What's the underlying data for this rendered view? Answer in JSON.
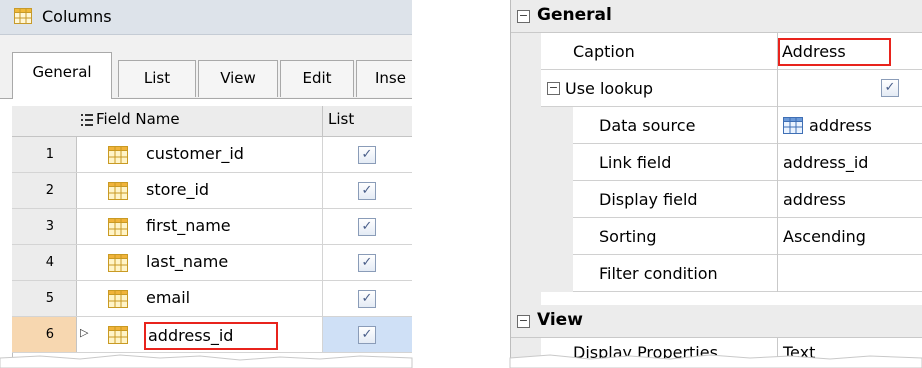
{
  "left_panel": {
    "title": "Columns",
    "tabs": [
      "General",
      "List",
      "View",
      "Edit",
      "Inse"
    ],
    "grid": {
      "header": {
        "field_name": "Field Name",
        "list": "List"
      },
      "rows": [
        {
          "num": "1",
          "name": "customer_id",
          "checked": true
        },
        {
          "num": "2",
          "name": "store_id",
          "checked": true
        },
        {
          "num": "3",
          "name": "first_name",
          "checked": true
        },
        {
          "num": "4",
          "name": "last_name",
          "checked": true
        },
        {
          "num": "5",
          "name": "email",
          "checked": true
        },
        {
          "num": "6",
          "name": "address_id",
          "checked": true,
          "selected": true
        }
      ]
    }
  },
  "right_panel": {
    "general": {
      "label": "General",
      "expand_glyph": "⊟",
      "caption_label": "Caption",
      "caption_value": "Address",
      "use_lookup_label": "Use lookup",
      "use_lookup_checked": true,
      "data_source_label": "Data source",
      "data_source_value": "address",
      "link_field_label": "Link field",
      "link_field_value": "address_id",
      "display_field_label": "Display field",
      "display_field_value": "address",
      "sorting_label": "Sorting",
      "sorting_value": "Ascending",
      "filter_condition_label": "Filter condition",
      "filter_condition_value": ""
    },
    "view": {
      "label": "View",
      "display_properties_label": "Display Properties",
      "display_properties_value": "Text"
    }
  },
  "colors": {
    "highlight_red": "#e8231c",
    "selected_row_num": "#f7d7b0",
    "selected_list_cell": "#cfe0f6",
    "titlebar": "#dde3ea"
  }
}
